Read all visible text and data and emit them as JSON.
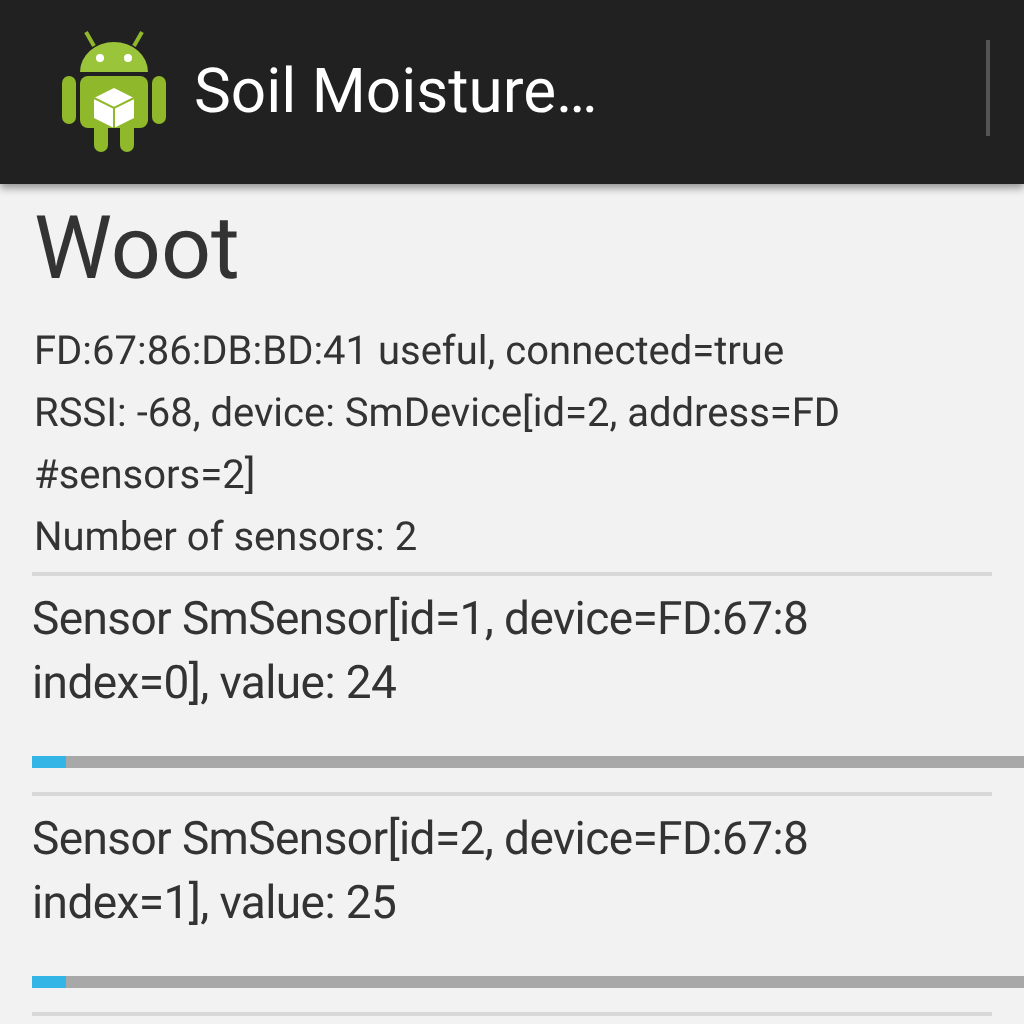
{
  "action_bar": {
    "title": "Soil Moisture…"
  },
  "heading": "Woot",
  "info_lines": [
    "FD:67:86:DB:BD:41 useful, connected=true",
    "RSSI: -68, device: SmDevice[id=2, address=FD",
    "#sensors=2]",
    "Number of sensors: 2"
  ],
  "sensors": [
    {
      "lines": [
        "Sensor SmSensor[id=1, device=FD:67:8",
        "index=0], value: 24"
      ],
      "level": 0.035
    },
    {
      "lines": [
        "Sensor SmSensor[id=2, device=FD:67:8",
        "index=1], value: 25"
      ],
      "level": 0.035
    }
  ]
}
